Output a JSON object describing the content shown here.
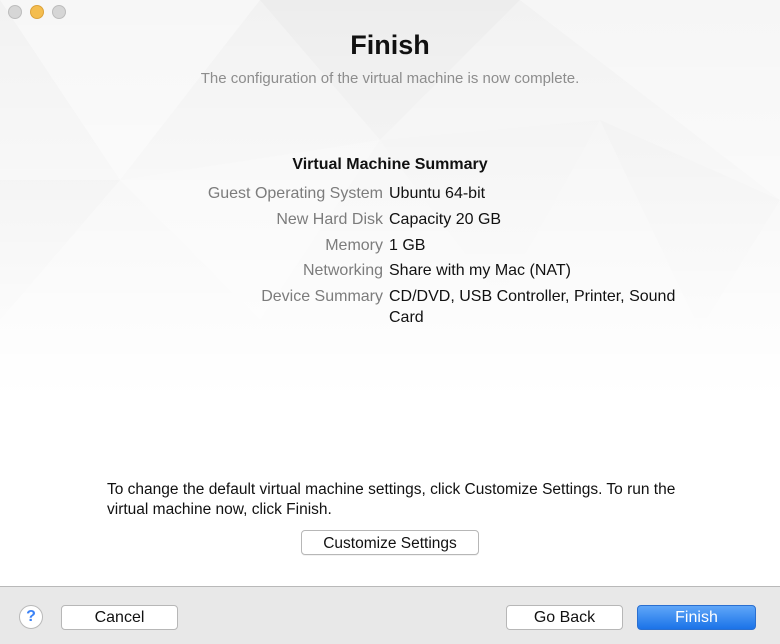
{
  "window": {
    "title": "Finish",
    "subtitle": "The configuration of the virtual machine is now complete."
  },
  "summary": {
    "heading": "Virtual Machine Summary",
    "rows": [
      {
        "label": "Guest Operating System",
        "value": "Ubuntu 64-bit"
      },
      {
        "label": "New Hard Disk",
        "value": "Capacity 20 GB"
      },
      {
        "label": "Memory",
        "value": "1 GB"
      },
      {
        "label": "Networking",
        "value": "Share with my Mac (NAT)"
      },
      {
        "label": "Device Summary",
        "value": "CD/DVD, USB Controller, Printer, Sound Card"
      }
    ]
  },
  "info_text": "To change the default virtual machine settings, click Customize Settings. To run the virtual machine now, click Finish.",
  "buttons": {
    "customize": "Customize Settings",
    "help": "?",
    "cancel": "Cancel",
    "go_back": "Go Back",
    "finish": "Finish"
  },
  "colors": {
    "accent": "#1b73e8",
    "minimize": "#f4bd4f"
  }
}
